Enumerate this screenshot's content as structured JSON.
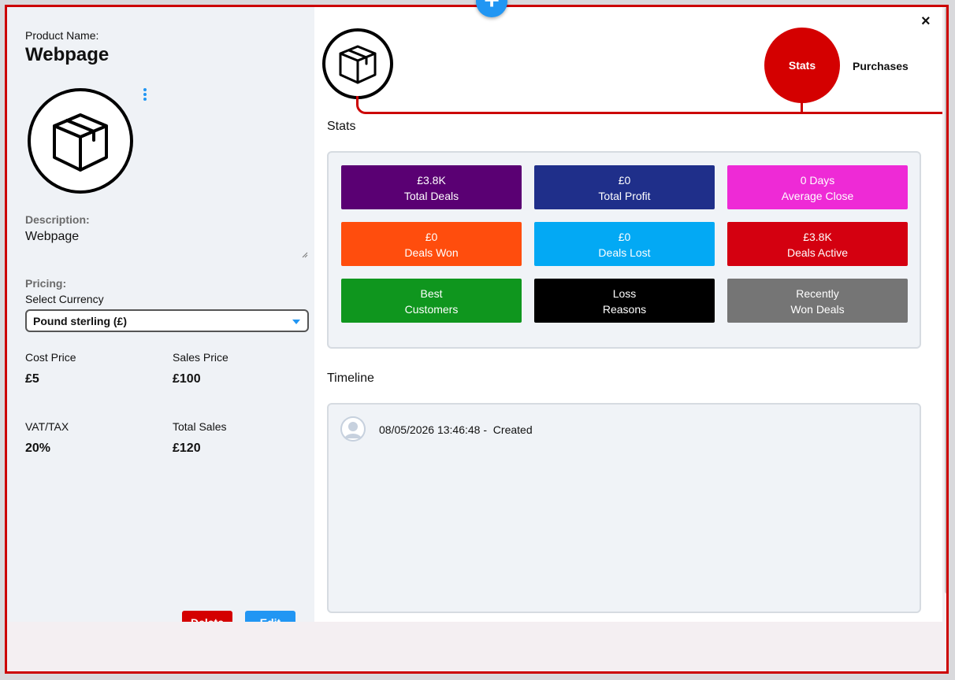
{
  "product": {
    "name_label": "Product Name:",
    "name": "Webpage",
    "description_label": "Description:",
    "description": "Webpage",
    "pricing_label": "Pricing:",
    "currency_label": "Select Currency",
    "currency_selected": "Pound sterling (£)",
    "fields": {
      "cost_label": "Cost Price",
      "cost_value": "£5",
      "sales_label": "Sales Price",
      "sales_value": "£100",
      "vat_label": "VAT/TAX",
      "vat_value": "20%",
      "total_label": "Total Sales",
      "total_value": "£120"
    },
    "delete_label": "Delete",
    "edit_label": "Edit"
  },
  "tabs": {
    "stats": "Stats",
    "purchases": "Purchases"
  },
  "stats": {
    "title": "Stats",
    "tiles": [
      {
        "line1": "£3.8K",
        "line2": "Total Deals",
        "color": "#5a0073"
      },
      {
        "line1": "£0",
        "line2": "Total Profit",
        "color": "#1f2f8a"
      },
      {
        "line1": "0 Days",
        "line2": "Average Close",
        "color": "#ee2ad6"
      },
      {
        "line1": "£0",
        "line2": "Deals Won",
        "color": "#ff4d0d"
      },
      {
        "line1": "£0",
        "line2": "Deals Lost",
        "color": "#03a9f4"
      },
      {
        "line1": "£3.8K",
        "line2": "Deals Active",
        "color": "#d40010"
      },
      {
        "line1": "Best",
        "line2": "Customers",
        "color": "#0f961e"
      },
      {
        "line1": "Loss",
        "line2": "Reasons",
        "color": "#000000"
      },
      {
        "line1": "Recently",
        "line2": "Won Deals",
        "color": "#757575"
      }
    ]
  },
  "timeline": {
    "title": "Timeline",
    "entries": [
      {
        "timestamp": "08/05/2026 13:46:48 -",
        "event": "Created"
      }
    ]
  },
  "icons": {
    "add": "plus-icon",
    "close": "close-icon",
    "product": "package-box-icon",
    "menu": "kebab-menu-icon",
    "user": "user-avatar-icon"
  },
  "colors": {
    "accent_red": "#cc0000",
    "primary_blue": "#2196f3"
  }
}
